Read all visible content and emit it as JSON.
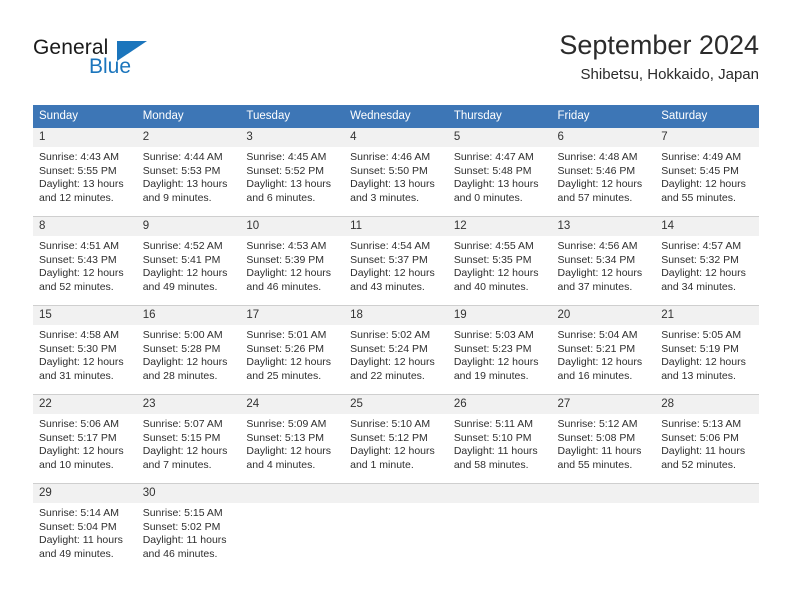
{
  "brand": {
    "word_general": "General",
    "word_blue": "Blue"
  },
  "header": {
    "title": "September 2024",
    "subtitle": "Shibetsu, Hokkaido, Japan"
  },
  "colors": {
    "header_blue": "#3d76b6",
    "brand_blue": "#1b75bc",
    "daynum_band": "#f1f1f1",
    "grid_line": "#cfcfcf"
  },
  "weekday_headers": [
    "Sunday",
    "Monday",
    "Tuesday",
    "Wednesday",
    "Thursday",
    "Friday",
    "Saturday"
  ],
  "weeks": [
    [
      {
        "day": "1",
        "sunrise": "Sunrise: 4:43 AM",
        "sunset": "Sunset: 5:55 PM",
        "daylight_line1": "Daylight: 13 hours",
        "daylight_line2": "and 12 minutes."
      },
      {
        "day": "2",
        "sunrise": "Sunrise: 4:44 AM",
        "sunset": "Sunset: 5:53 PM",
        "daylight_line1": "Daylight: 13 hours",
        "daylight_line2": "and 9 minutes."
      },
      {
        "day": "3",
        "sunrise": "Sunrise: 4:45 AM",
        "sunset": "Sunset: 5:52 PM",
        "daylight_line1": "Daylight: 13 hours",
        "daylight_line2": "and 6 minutes."
      },
      {
        "day": "4",
        "sunrise": "Sunrise: 4:46 AM",
        "sunset": "Sunset: 5:50 PM",
        "daylight_line1": "Daylight: 13 hours",
        "daylight_line2": "and 3 minutes."
      },
      {
        "day": "5",
        "sunrise": "Sunrise: 4:47 AM",
        "sunset": "Sunset: 5:48 PM",
        "daylight_line1": "Daylight: 13 hours",
        "daylight_line2": "and 0 minutes."
      },
      {
        "day": "6",
        "sunrise": "Sunrise: 4:48 AM",
        "sunset": "Sunset: 5:46 PM",
        "daylight_line1": "Daylight: 12 hours",
        "daylight_line2": "and 57 minutes."
      },
      {
        "day": "7",
        "sunrise": "Sunrise: 4:49 AM",
        "sunset": "Sunset: 5:45 PM",
        "daylight_line1": "Daylight: 12 hours",
        "daylight_line2": "and 55 minutes."
      }
    ],
    [
      {
        "day": "8",
        "sunrise": "Sunrise: 4:51 AM",
        "sunset": "Sunset: 5:43 PM",
        "daylight_line1": "Daylight: 12 hours",
        "daylight_line2": "and 52 minutes."
      },
      {
        "day": "9",
        "sunrise": "Sunrise: 4:52 AM",
        "sunset": "Sunset: 5:41 PM",
        "daylight_line1": "Daylight: 12 hours",
        "daylight_line2": "and 49 minutes."
      },
      {
        "day": "10",
        "sunrise": "Sunrise: 4:53 AM",
        "sunset": "Sunset: 5:39 PM",
        "daylight_line1": "Daylight: 12 hours",
        "daylight_line2": "and 46 minutes."
      },
      {
        "day": "11",
        "sunrise": "Sunrise: 4:54 AM",
        "sunset": "Sunset: 5:37 PM",
        "daylight_line1": "Daylight: 12 hours",
        "daylight_line2": "and 43 minutes."
      },
      {
        "day": "12",
        "sunrise": "Sunrise: 4:55 AM",
        "sunset": "Sunset: 5:35 PM",
        "daylight_line1": "Daylight: 12 hours",
        "daylight_line2": "and 40 minutes."
      },
      {
        "day": "13",
        "sunrise": "Sunrise: 4:56 AM",
        "sunset": "Sunset: 5:34 PM",
        "daylight_line1": "Daylight: 12 hours",
        "daylight_line2": "and 37 minutes."
      },
      {
        "day": "14",
        "sunrise": "Sunrise: 4:57 AM",
        "sunset": "Sunset: 5:32 PM",
        "daylight_line1": "Daylight: 12 hours",
        "daylight_line2": "and 34 minutes."
      }
    ],
    [
      {
        "day": "15",
        "sunrise": "Sunrise: 4:58 AM",
        "sunset": "Sunset: 5:30 PM",
        "daylight_line1": "Daylight: 12 hours",
        "daylight_line2": "and 31 minutes."
      },
      {
        "day": "16",
        "sunrise": "Sunrise: 5:00 AM",
        "sunset": "Sunset: 5:28 PM",
        "daylight_line1": "Daylight: 12 hours",
        "daylight_line2": "and 28 minutes."
      },
      {
        "day": "17",
        "sunrise": "Sunrise: 5:01 AM",
        "sunset": "Sunset: 5:26 PM",
        "daylight_line1": "Daylight: 12 hours",
        "daylight_line2": "and 25 minutes."
      },
      {
        "day": "18",
        "sunrise": "Sunrise: 5:02 AM",
        "sunset": "Sunset: 5:24 PM",
        "daylight_line1": "Daylight: 12 hours",
        "daylight_line2": "and 22 minutes."
      },
      {
        "day": "19",
        "sunrise": "Sunrise: 5:03 AM",
        "sunset": "Sunset: 5:23 PM",
        "daylight_line1": "Daylight: 12 hours",
        "daylight_line2": "and 19 minutes."
      },
      {
        "day": "20",
        "sunrise": "Sunrise: 5:04 AM",
        "sunset": "Sunset: 5:21 PM",
        "daylight_line1": "Daylight: 12 hours",
        "daylight_line2": "and 16 minutes."
      },
      {
        "day": "21",
        "sunrise": "Sunrise: 5:05 AM",
        "sunset": "Sunset: 5:19 PM",
        "daylight_line1": "Daylight: 12 hours",
        "daylight_line2": "and 13 minutes."
      }
    ],
    [
      {
        "day": "22",
        "sunrise": "Sunrise: 5:06 AM",
        "sunset": "Sunset: 5:17 PM",
        "daylight_line1": "Daylight: 12 hours",
        "daylight_line2": "and 10 minutes."
      },
      {
        "day": "23",
        "sunrise": "Sunrise: 5:07 AM",
        "sunset": "Sunset: 5:15 PM",
        "daylight_line1": "Daylight: 12 hours",
        "daylight_line2": "and 7 minutes."
      },
      {
        "day": "24",
        "sunrise": "Sunrise: 5:09 AM",
        "sunset": "Sunset: 5:13 PM",
        "daylight_line1": "Daylight: 12 hours",
        "daylight_line2": "and 4 minutes."
      },
      {
        "day": "25",
        "sunrise": "Sunrise: 5:10 AM",
        "sunset": "Sunset: 5:12 PM",
        "daylight_line1": "Daylight: 12 hours",
        "daylight_line2": "and 1 minute."
      },
      {
        "day": "26",
        "sunrise": "Sunrise: 5:11 AM",
        "sunset": "Sunset: 5:10 PM",
        "daylight_line1": "Daylight: 11 hours",
        "daylight_line2": "and 58 minutes."
      },
      {
        "day": "27",
        "sunrise": "Sunrise: 5:12 AM",
        "sunset": "Sunset: 5:08 PM",
        "daylight_line1": "Daylight: 11 hours",
        "daylight_line2": "and 55 minutes."
      },
      {
        "day": "28",
        "sunrise": "Sunrise: 5:13 AM",
        "sunset": "Sunset: 5:06 PM",
        "daylight_line1": "Daylight: 11 hours",
        "daylight_line2": "and 52 minutes."
      }
    ],
    [
      {
        "day": "29",
        "sunrise": "Sunrise: 5:14 AM",
        "sunset": "Sunset: 5:04 PM",
        "daylight_line1": "Daylight: 11 hours",
        "daylight_line2": "and 49 minutes."
      },
      {
        "day": "30",
        "sunrise": "Sunrise: 5:15 AM",
        "sunset": "Sunset: 5:02 PM",
        "daylight_line1": "Daylight: 11 hours",
        "daylight_line2": "and 46 minutes."
      },
      {
        "day": "",
        "sunrise": "",
        "sunset": "",
        "daylight_line1": "",
        "daylight_line2": ""
      },
      {
        "day": "",
        "sunrise": "",
        "sunset": "",
        "daylight_line1": "",
        "daylight_line2": ""
      },
      {
        "day": "",
        "sunrise": "",
        "sunset": "",
        "daylight_line1": "",
        "daylight_line2": ""
      },
      {
        "day": "",
        "sunrise": "",
        "sunset": "",
        "daylight_line1": "",
        "daylight_line2": ""
      },
      {
        "day": "",
        "sunrise": "",
        "sunset": "",
        "daylight_line1": "",
        "daylight_line2": ""
      }
    ]
  ]
}
